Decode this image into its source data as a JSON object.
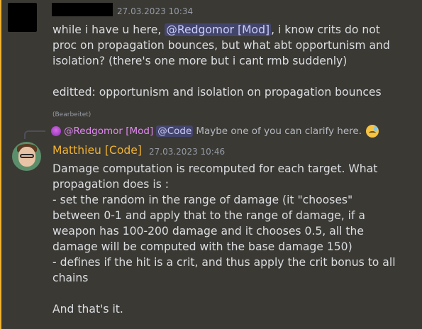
{
  "message1": {
    "timestamp": "27.03.2023 10:34",
    "lines": [
      {
        "pre": "while i have u here, ",
        "mention": "@Redgomor [Mod]",
        "post": ", i know crits do not"
      },
      {
        "text": "proc on propagation bounces, but what abt opportunism and"
      },
      {
        "text": "isolation? (there's one more but i cant rmb suddenly)"
      },
      {
        "text": ""
      },
      {
        "text": "editted: opportunism and isolation on propagation bounces"
      }
    ],
    "edited_label": "(Bearbeitet)"
  },
  "reply": {
    "author": "@Redgomor [Mod]",
    "mention": "@Code",
    "text": "Maybe one of you can clarify here.",
    "emoji_icon": "sweat-smile-emoji"
  },
  "message2": {
    "author": "Matthieu [Code]",
    "author_color": "#f0b232",
    "timestamp": "27.03.2023 10:46",
    "lines": [
      "Damage computation is recomputed for each target. What",
      "propagation does is :",
      "- set the random in the range of damage (it \"chooses\"",
      "between 0-1 and apply that to the range of damage, if a",
      "weapon has 100-200 damage and it chooses 0.5, all the",
      "damage will be computed with the base damage 150)",
      "- defines if the hit is a crit, and thus apply the crit bonus to all",
      "chains",
      "",
      "And that's it."
    ]
  },
  "colors": {
    "highlight": "#f0b232",
    "background": "#3b3934",
    "mention_bg": "rgba(88,101,242,0.3)"
  }
}
